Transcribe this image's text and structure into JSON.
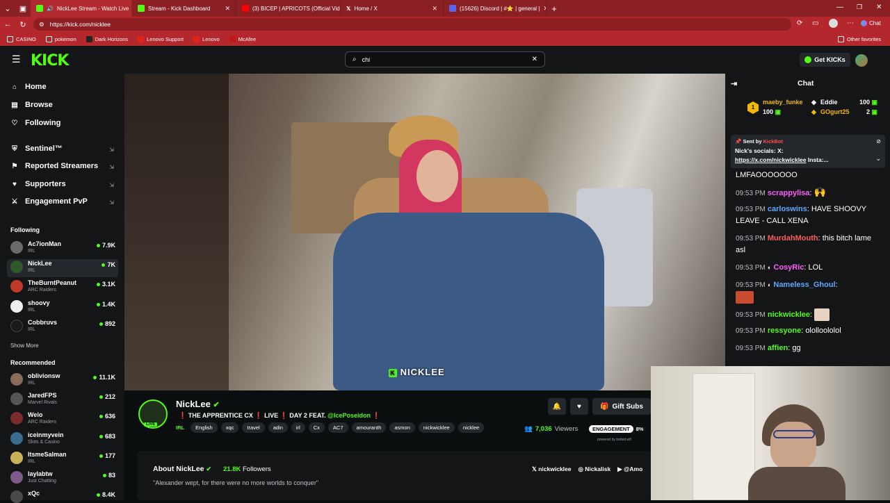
{
  "browser": {
    "tabs": [
      {
        "title": "NickLee Stream - Watch Live",
        "color": "#53fc18",
        "active": true
      },
      {
        "title": "Stream - Kick Dashboard",
        "color": "#53fc18",
        "active": false
      },
      {
        "title": "(3) BICEP | APRICOTS (Official Vide",
        "color": "#ff0000",
        "active": false
      },
      {
        "title": "Home / X",
        "color": "#000000",
        "active": false
      },
      {
        "title": "(15626) Discord | #⭐ | general |",
        "color": "#5865f2",
        "active": false
      }
    ],
    "url": "https://kick.com/nicklee",
    "bookmarks": [
      "CASINO",
      "pokemon",
      "Dark Horizons",
      "Lenovo Support",
      "Lenovo",
      "McAfee"
    ],
    "other_favorites": "Other favorites",
    "chat_button": "Chat"
  },
  "kick": {
    "logo": "KICK",
    "search_value": "chi",
    "get_kicks": "Get KICKs"
  },
  "sidebar": {
    "nav": [
      {
        "label": "Home",
        "icon": "home-icon"
      },
      {
        "label": "Browse",
        "icon": "browse-icon"
      },
      {
        "label": "Following",
        "icon": "heart-icon"
      }
    ],
    "premium": [
      {
        "label": "Sentinel™",
        "icon": "shield-icon"
      },
      {
        "label": "Reported Streamers",
        "icon": "flag-icon"
      },
      {
        "label": "Supporters",
        "icon": "heart-icon"
      },
      {
        "label": "Engagement PvP",
        "icon": "sword-icon"
      }
    ],
    "following_title": "Following",
    "following": [
      {
        "name": "Ac7ionMan",
        "category": "IRL",
        "viewers": "7.9K",
        "color": "#6b6b6b"
      },
      {
        "name": "NickLee",
        "category": "IRL",
        "viewers": "7K",
        "color": "#2f5a2a"
      },
      {
        "name": "TheBurntPeanut",
        "category": "ARC Raiders",
        "viewers": "3.1K",
        "color": "#c0392b"
      },
      {
        "name": "shoovy",
        "category": "IRL",
        "viewers": "1.4K",
        "color": "#eeeeee"
      },
      {
        "name": "Cobbruvs",
        "category": "IRL",
        "viewers": "892",
        "color": "#1a1a1a"
      }
    ],
    "show_more": "Show More",
    "recommended_title": "Recommended",
    "recommended": [
      {
        "name": "oblivionsw",
        "category": "IRL",
        "viewers": "11.1K",
        "color": "#8a6d5a"
      },
      {
        "name": "JaredFPS",
        "category": "Marvel Rivals",
        "viewers": "212",
        "color": "#555555"
      },
      {
        "name": "Welo",
        "category": "ARC Raiders",
        "viewers": "636",
        "color": "#7a2c2c"
      },
      {
        "name": "iceinmyvein",
        "category": "Slots & Casino",
        "viewers": "683",
        "color": "#3b6b8f"
      },
      {
        "name": "ItsmeSalman",
        "category": "IRL",
        "viewers": "177",
        "color": "#c9b25a"
      },
      {
        "name": "laylabtw",
        "category": "Just Chatting",
        "viewers": "83",
        "color": "#7d5a8a"
      },
      {
        "name": "xQc",
        "category": "",
        "viewers": "8.4K",
        "color": "#4a4a4a"
      }
    ]
  },
  "video": {
    "caption": "NICKLEE"
  },
  "stream": {
    "name": "NickLee",
    "live": "LIVE",
    "title_prefix": "❗ THE APPRENTICE CX ❗ LIVE ❗ DAY 2 FEAT.",
    "title_mention": "@IcePoseidon",
    "title_suffix": "❗",
    "category": "IRL",
    "tags": [
      "English",
      "xqc",
      "travel",
      "adin",
      "irl",
      "Cx",
      "AC7",
      "amouranth",
      "asmon",
      "nickwicklee",
      "nicklee"
    ],
    "gift_subs": "Gift Subs",
    "viewers_count": "7,036",
    "viewers_label": "Viewers",
    "engagement_label": "ENGAGEMENT",
    "engagement_value": "8%",
    "powered_by": "powered by botted.wtf"
  },
  "about": {
    "title": "About NickLee",
    "followers_count": "21.8K",
    "followers_label": "Followers",
    "bio": "\"Alexander wept, for there were no more worlds to conquer\"",
    "socials": [
      "nickwicklee",
      "Nickalisk",
      "@Amo"
    ]
  },
  "chat": {
    "title": "Chat",
    "gifters": [
      {
        "name": "maeby_funke",
        "count": "100",
        "color": "#f5b800"
      },
      {
        "name": "Eddie",
        "count": "100",
        "color": "#ffffff"
      },
      {
        "name": "GOgurt25",
        "count": "2",
        "color": "#f5b800"
      }
    ],
    "pinned": {
      "sent_by": "Sent by",
      "bot": "KickBot",
      "text": "Nick's socials: X:",
      "link": "https://x.com/nickwicklee",
      "link_suffix": "Insta:..."
    },
    "messages": [
      {
        "time": "",
        "user": "",
        "color": "#ffffff",
        "text": "LMFAOOOOOOO"
      },
      {
        "time": "09:53 PM",
        "user": "scrappylisa",
        "color": "#ff5dfa",
        "text": ""
      },
      {
        "time": "09:53 PM",
        "user": "carloswins",
        "color": "#5da9ff",
        "text": "HAVE SHOOVY LEAVE - CALL XENA"
      },
      {
        "time": "09:53 PM",
        "user": "MurdahMouth",
        "color": "#ff5d5d",
        "text": "this bitch lame asl"
      },
      {
        "time": "09:53 PM",
        "user": "CosyRic",
        "color": "#ff5dfa",
        "text": "LOL"
      },
      {
        "time": "09:53 PM",
        "user": "Nameless_Ghoul",
        "color": "#5da9ff",
        "text": ""
      },
      {
        "time": "09:53 PM",
        "user": "nickwicklee",
        "color": "#53fc18",
        "text": ""
      },
      {
        "time": "09:53 PM",
        "user": "ressyone",
        "color": "#53fc18",
        "text": "ololloololol"
      },
      {
        "time": "09:53 PM",
        "user": "affien",
        "color": "#53fc18",
        "text": "gg"
      }
    ]
  }
}
